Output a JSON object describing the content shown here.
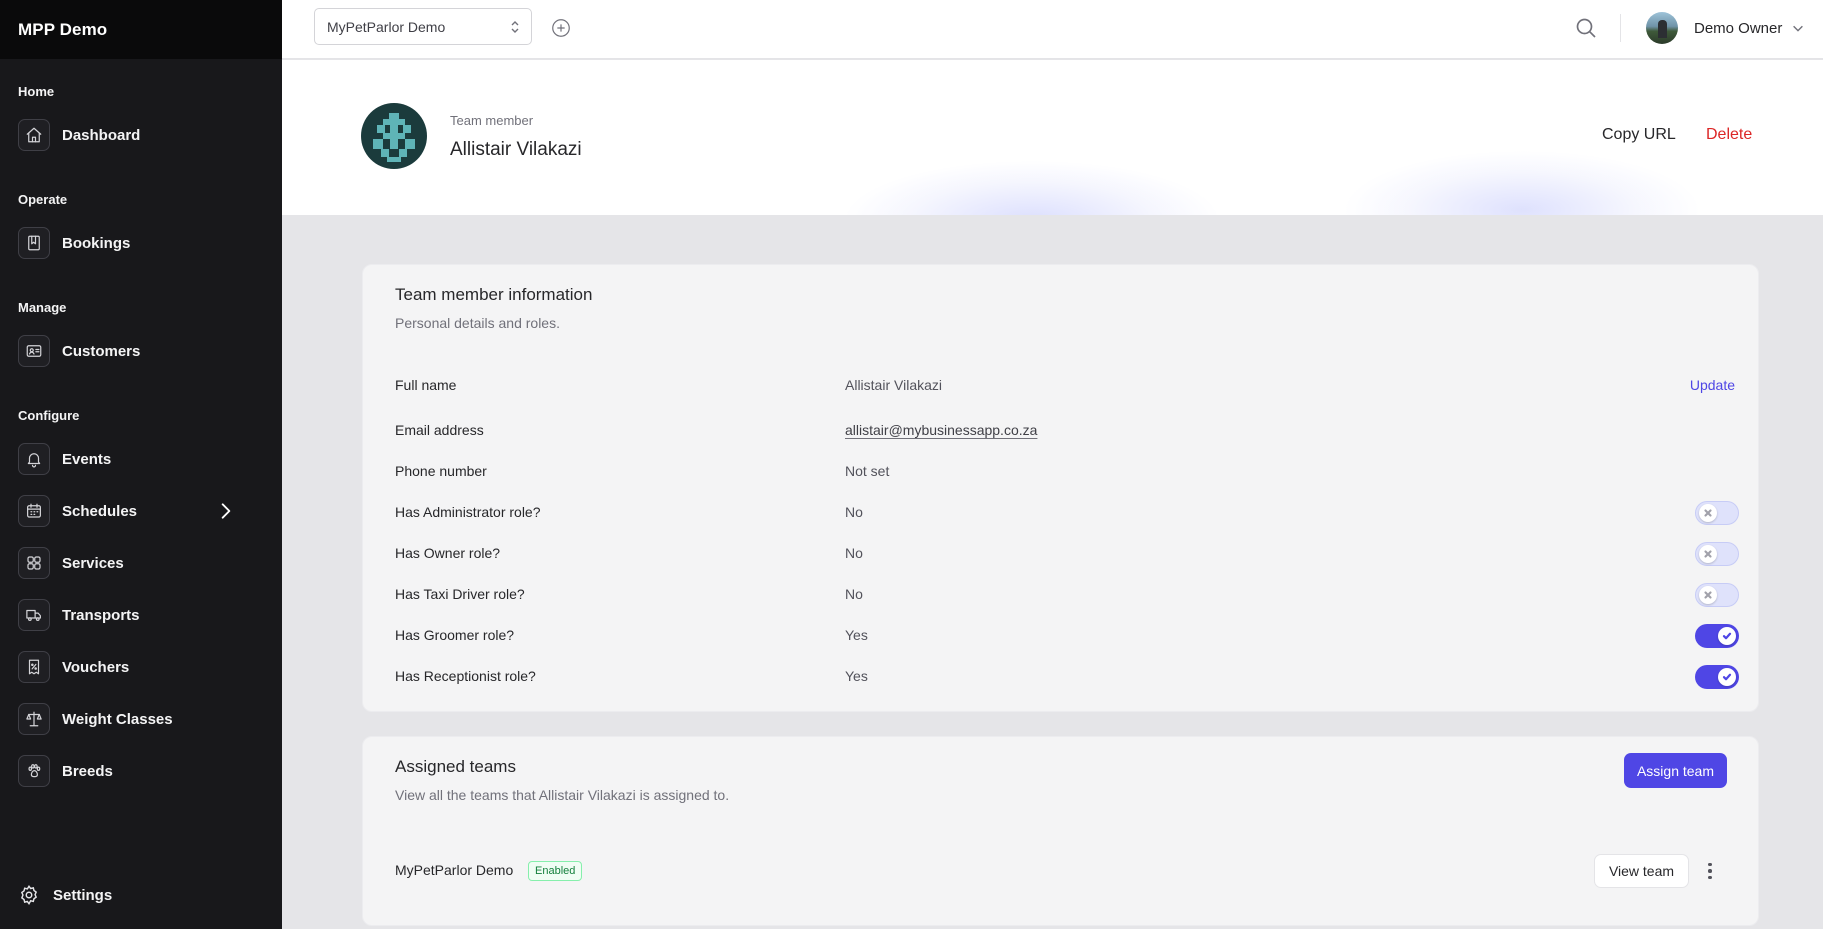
{
  "app": {
    "brand": "MPP Demo"
  },
  "sidebar": {
    "sections": [
      {
        "label": "Home",
        "items": [
          {
            "label": "Dashboard",
            "icon": "home-icon"
          }
        ]
      },
      {
        "label": "Operate",
        "items": [
          {
            "label": "Bookings",
            "icon": "book-icon"
          }
        ]
      },
      {
        "label": "Manage",
        "items": [
          {
            "label": "Customers",
            "icon": "id-card-icon"
          }
        ]
      },
      {
        "label": "Configure",
        "items": [
          {
            "label": "Events",
            "icon": "bell-icon"
          },
          {
            "label": "Schedules",
            "icon": "calendar-icon",
            "has_submenu": true
          },
          {
            "label": "Services",
            "icon": "grid-icon"
          },
          {
            "label": "Transports",
            "icon": "truck-icon"
          },
          {
            "label": "Vouchers",
            "icon": "voucher-icon"
          },
          {
            "label": "Weight Classes",
            "icon": "scale-icon"
          },
          {
            "label": "Breeds",
            "icon": "paw-icon"
          }
        ]
      }
    ],
    "settings_label": "Settings"
  },
  "topbar": {
    "org_selected": "MyPetParlor Demo",
    "user_name": "Demo Owner"
  },
  "header": {
    "eyebrow": "Team member",
    "name": "Allistair Vilakazi",
    "copy_url_label": "Copy URL",
    "delete_label": "Delete"
  },
  "info_card": {
    "title": "Team member information",
    "subtitle": "Personal details and roles.",
    "update_label": "Update",
    "rows": [
      {
        "label": "Full name",
        "value": "Allistair Vilakazi"
      },
      {
        "label": "Email address",
        "value": "allistair@mybusinessapp.co.za"
      },
      {
        "label": "Phone number",
        "value": "Not set"
      },
      {
        "label": "Has Administrator role?",
        "value": "No",
        "toggle": false
      },
      {
        "label": "Has Owner role?",
        "value": "No",
        "toggle": false
      },
      {
        "label": "Has Taxi Driver role?",
        "value": "No",
        "toggle": false
      },
      {
        "label": "Has Groomer role?",
        "value": "Yes",
        "toggle": true
      },
      {
        "label": "Has Receptionist role?",
        "value": "Yes",
        "toggle": true
      }
    ]
  },
  "teams_card": {
    "title": "Assigned teams",
    "subtitle": "View all the teams that Allistair Vilakazi is assigned to.",
    "assign_label": "Assign team",
    "teams": [
      {
        "name": "MyPetParlor Demo",
        "status": "Enabled",
        "view_label": "View team"
      }
    ]
  },
  "colors": {
    "accent": "#4f46e5",
    "danger": "#dc2626",
    "sidebar": "#18181b",
    "success": "#15803d"
  }
}
